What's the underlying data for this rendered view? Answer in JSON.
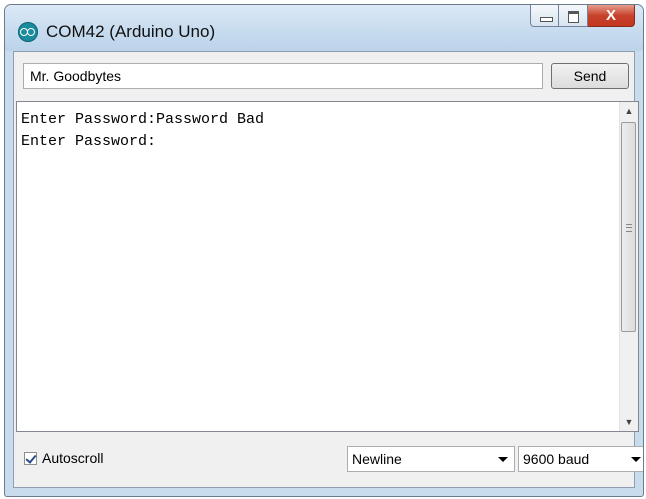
{
  "window": {
    "title": "COM42 (Arduino Uno)",
    "icon": "arduino-icon",
    "caption_buttons": [
      "minimize",
      "maximize",
      "close"
    ],
    "close_label": "X"
  },
  "input": {
    "value": "Mr. Goodbytes"
  },
  "send_button": {
    "label": "Send"
  },
  "console": {
    "text": "Enter Password:Password Bad\nEnter Password:"
  },
  "scrollbar": {
    "up_arrow": "▲",
    "down_arrow": "▼"
  },
  "footer": {
    "autoscroll_label": "Autoscroll",
    "autoscroll_checked": true,
    "line_ending": "Newline",
    "baud": "9600 baud"
  }
}
